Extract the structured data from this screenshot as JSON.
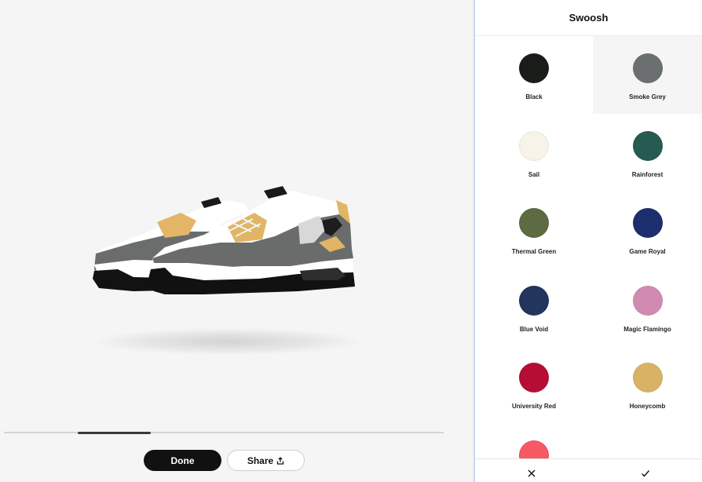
{
  "viewer": {
    "progress_fraction": 0.167,
    "progress_start_fraction": 0.167,
    "done_label": "Done",
    "share_label": "Share"
  },
  "panel": {
    "title": "Swoosh",
    "selected": "Smoke Grey",
    "colors": [
      {
        "label": "Black",
        "hex": "#1a1c1a"
      },
      {
        "label": "Smoke Grey",
        "hex": "#6b6f70"
      },
      {
        "label": "Sail",
        "hex": "#f8f3e8"
      },
      {
        "label": "Rainforest",
        "hex": "#265b51"
      },
      {
        "label": "Thermal Green",
        "hex": "#5c6b41"
      },
      {
        "label": "Game Royal",
        "hex": "#1c2e6e"
      },
      {
        "label": "Blue Void",
        "hex": "#23355c"
      },
      {
        "label": "Magic Flamingo",
        "hex": "#d08cb0"
      },
      {
        "label": "University Red",
        "hex": "#b50d34"
      },
      {
        "label": "Honeycomb",
        "hex": "#d8b365"
      },
      {
        "label": "",
        "hex": "#f55963"
      }
    ],
    "footer": {
      "cancel_icon": "close-icon",
      "confirm_icon": "check-icon"
    }
  }
}
